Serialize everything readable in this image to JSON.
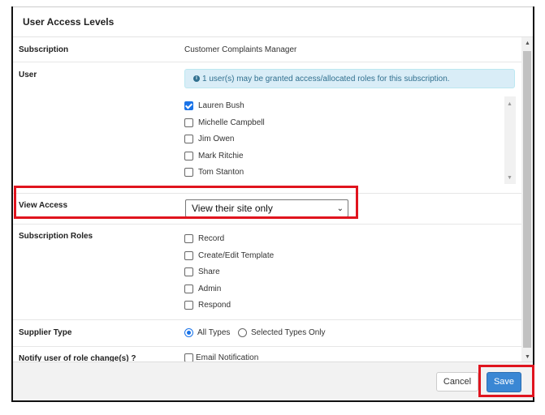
{
  "dialog": {
    "title": "User Access Levels"
  },
  "subscription": {
    "label": "Subscription",
    "value": "Customer Complaints Manager"
  },
  "user": {
    "label": "User",
    "info": "1 user(s) may be granted access/allocated roles for this subscription.",
    "users": [
      {
        "name": "Lauren Bush",
        "checked": true
      },
      {
        "name": "Michelle Campbell",
        "checked": false
      },
      {
        "name": "Jim Owen",
        "checked": false
      },
      {
        "name": "Mark Ritchie",
        "checked": false
      },
      {
        "name": "Tom Stanton",
        "checked": false
      }
    ]
  },
  "view_access": {
    "label": "View Access",
    "selected": "View their site only"
  },
  "roles": {
    "label": "Subscription Roles",
    "items": [
      "Record",
      "Create/Edit Template",
      "Share",
      "Admin",
      "Respond"
    ]
  },
  "supplier": {
    "label": "Supplier Type",
    "options": [
      {
        "label": "All Types",
        "selected": true
      },
      {
        "label": "Selected Types Only",
        "selected": false
      }
    ]
  },
  "notify": {
    "label": "Notify user of role change(s) ?",
    "option": "Email Notification"
  },
  "footer": {
    "cancel_label": "Cancel",
    "save_label": "Save"
  },
  "colors": {
    "highlight": "#e0141e",
    "primary": "#3a87d4",
    "info_bg": "#d9edf7"
  }
}
